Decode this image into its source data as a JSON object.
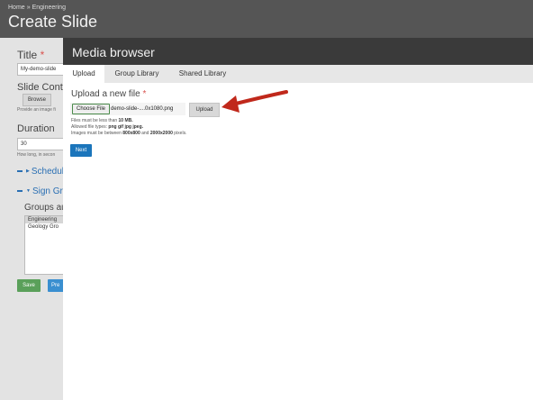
{
  "header": {
    "breadcrumb": [
      "Home",
      "Engineering"
    ],
    "breadcrumb_sep": "»",
    "title": "Create Slide"
  },
  "form": {
    "title_label": "Title",
    "title_value": "My-demo-slide",
    "slide_content_label": "Slide Conte",
    "browse_label": "Browse",
    "slide_content_help": "Provide an image fi",
    "duration_label": "Duration",
    "duration_value": "30",
    "duration_help": "How long, in secon",
    "schedule_label": "Schedul",
    "sign_groups_label": "Sign Gro",
    "groups_label": "Groups au",
    "groups": [
      {
        "label": "Engineering",
        "selected": true
      },
      {
        "label": "Geology Gro",
        "selected": false
      }
    ],
    "save_label": "Save",
    "preview_label": "Pre"
  },
  "modal": {
    "title": "Media browser",
    "tabs": [
      {
        "label": "Upload",
        "active": true
      },
      {
        "label": "Group Library",
        "active": false
      },
      {
        "label": "Shared Library",
        "active": false
      }
    ],
    "upload_heading": "Upload a new file",
    "choose_file_label": "Choose File",
    "file_name": "demo-slide-....0x1080.png",
    "upload_button": "Upload",
    "info_size_prefix": "Files must be less than ",
    "info_size_value": "10 MB.",
    "info_types_prefix": "Allowed file types: ",
    "info_types_value": "png gif jpg jpeg.",
    "info_dims_prefix": "Images must be between ",
    "info_dims_min": "800x800",
    "info_dims_and": " and ",
    "info_dims_max": "2000x2000",
    "info_dims_suffix": " pixels.",
    "next_label": "Next"
  },
  "colors": {
    "annotation_arrow": "#c0281b",
    "next_button": "#1b75bb"
  }
}
